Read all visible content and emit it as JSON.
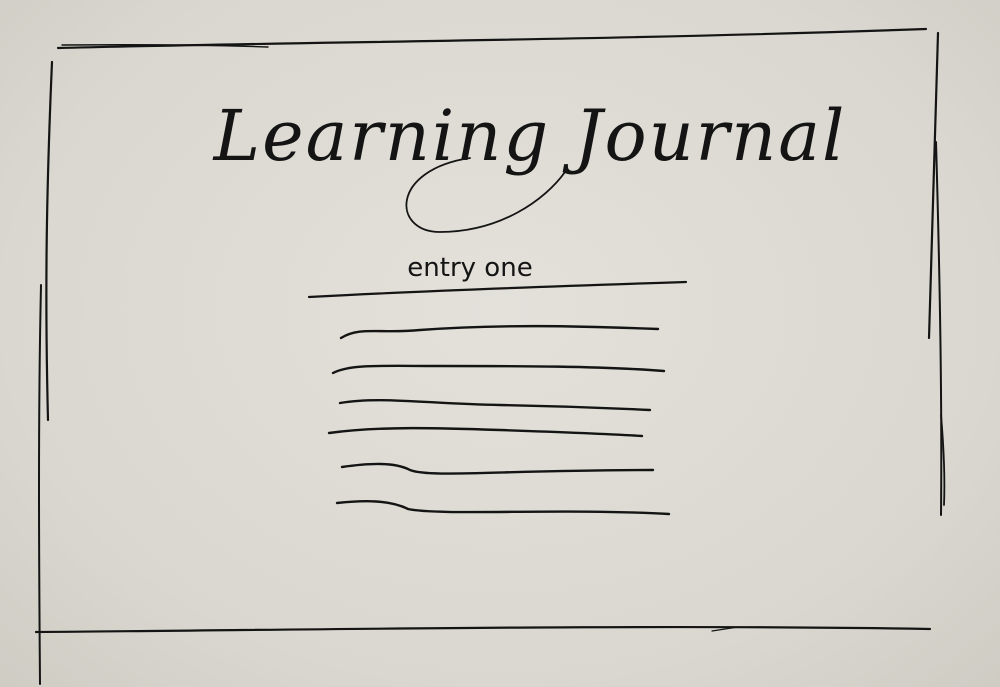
{
  "page": {
    "title": "Learning Journal"
  },
  "entry": {
    "title": "entry one",
    "text_line_count": 6
  },
  "colors": {
    "ink": "#141414",
    "paper": "#dcdad3"
  }
}
